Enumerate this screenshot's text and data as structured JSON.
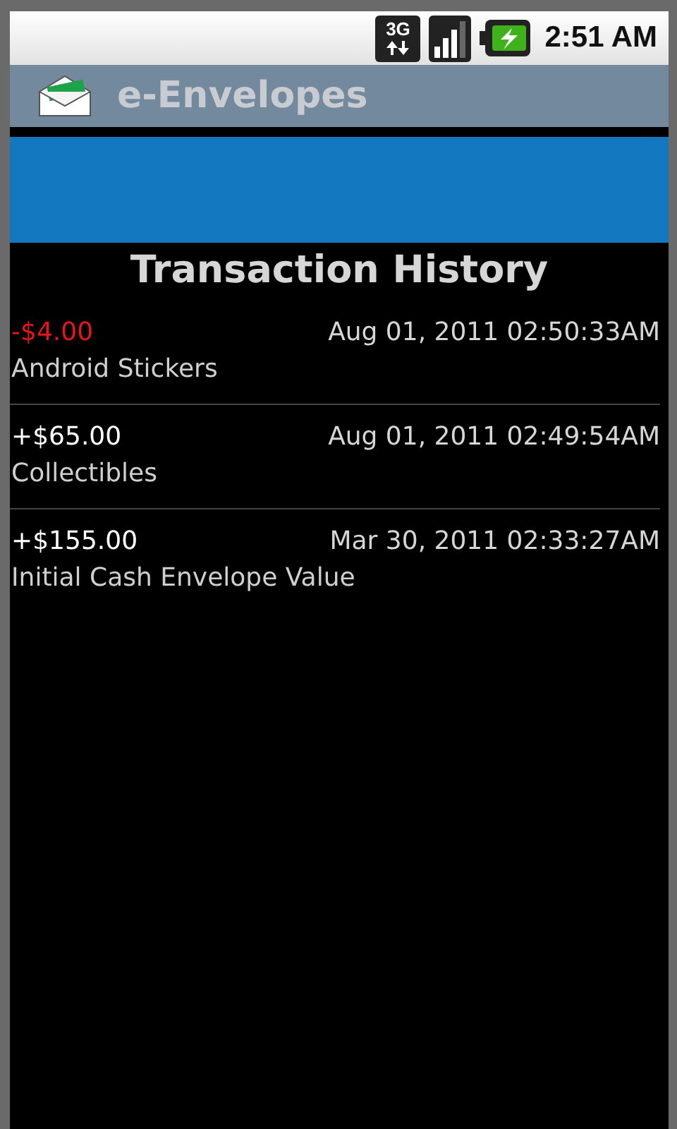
{
  "status_bar": {
    "time": "2:51 AM",
    "network": "3G"
  },
  "app_bar": {
    "title": "e-Envelopes"
  },
  "heading": "Transaction History",
  "transactions": [
    {
      "amount": "-$4.00",
      "kind": "debit",
      "date": "Aug 01, 2011 02:50:33AM",
      "description": "Android Stickers"
    },
    {
      "amount": "+$65.00",
      "kind": "credit",
      "date": "Aug 01, 2011 02:49:54AM",
      "description": "Collectibles"
    },
    {
      "amount": "+$155.00",
      "kind": "credit",
      "date": "Mar 30, 2011 02:33:27AM",
      "description": "Initial Cash Envelope Value"
    }
  ]
}
